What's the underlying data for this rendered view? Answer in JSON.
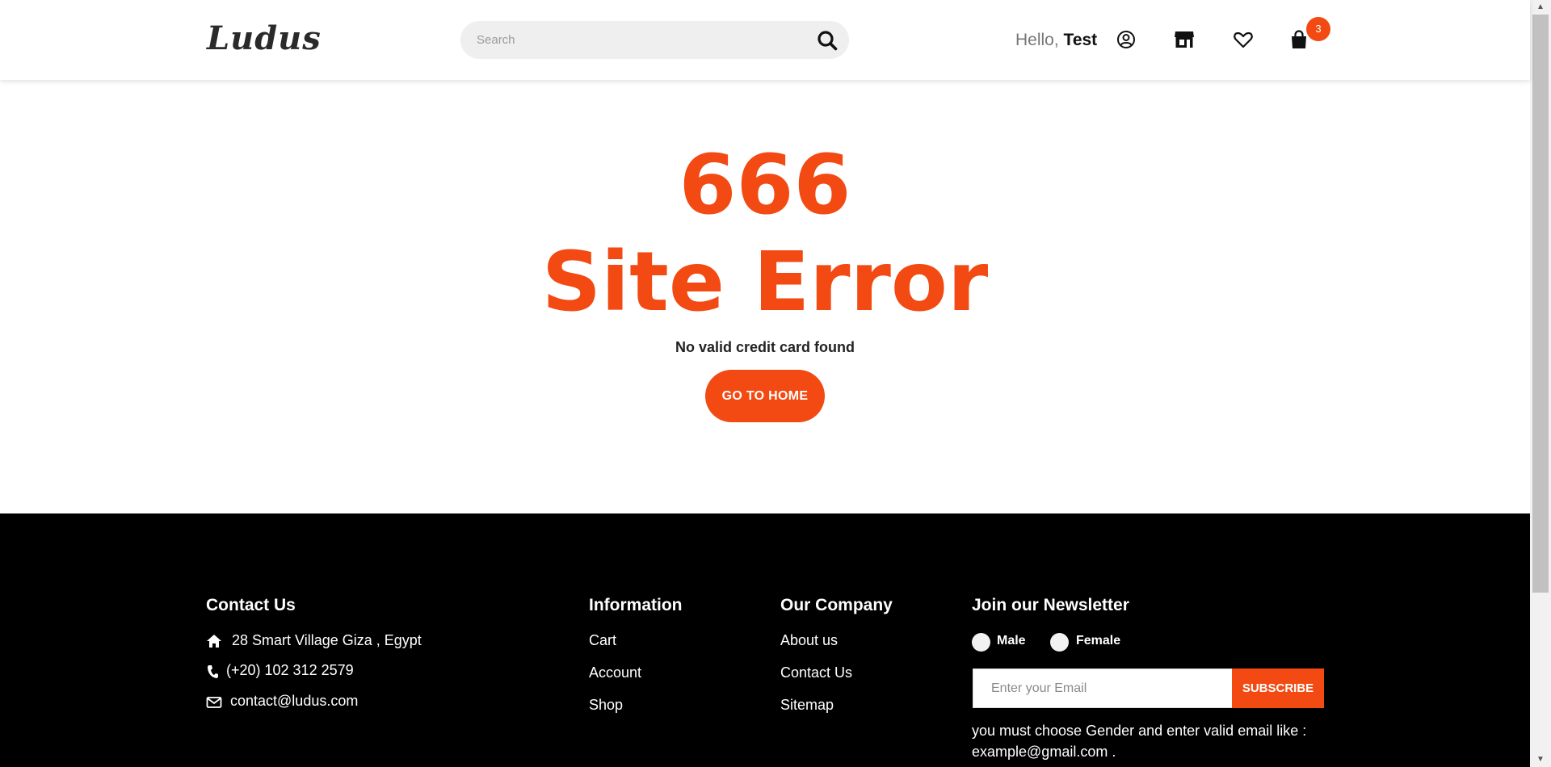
{
  "header": {
    "logo": "Ludus",
    "search": {
      "placeholder": "Search"
    },
    "greeting": "Hello,",
    "user_name": "Test",
    "cart_count": "3"
  },
  "main": {
    "error_code": "666",
    "error_title": "Site Error",
    "message": "No valid credit card found",
    "home_button": "GO TO HOME"
  },
  "footer": {
    "contact": {
      "heading": "Contact Us",
      "address": "28 Smart Village Giza , Egypt",
      "phone": "(+20) 102 312 2579",
      "email": "contact@ludus.com"
    },
    "information": {
      "heading": "Information",
      "links": [
        "Cart",
        "Account",
        "Shop"
      ]
    },
    "company": {
      "heading": "Our Company",
      "links": [
        "About us",
        "Contact Us",
        "Sitemap"
      ]
    },
    "newsletter": {
      "heading": "Join our Newsletter",
      "male_label": "Male",
      "female_label": "Female",
      "email_placeholder": "Enter your Email",
      "subscribe_label": "SUBSCRIBE",
      "note": "you must choose Gender and enter valid email like : example@gmail.com ."
    }
  },
  "colors": {
    "accent": "#f24a12",
    "footer_bg": "#000000"
  },
  "icons": [
    "search-icon",
    "user-icon",
    "store-icon",
    "heart-icon",
    "bag-icon",
    "home-icon",
    "phone-icon",
    "mail-icon"
  ]
}
